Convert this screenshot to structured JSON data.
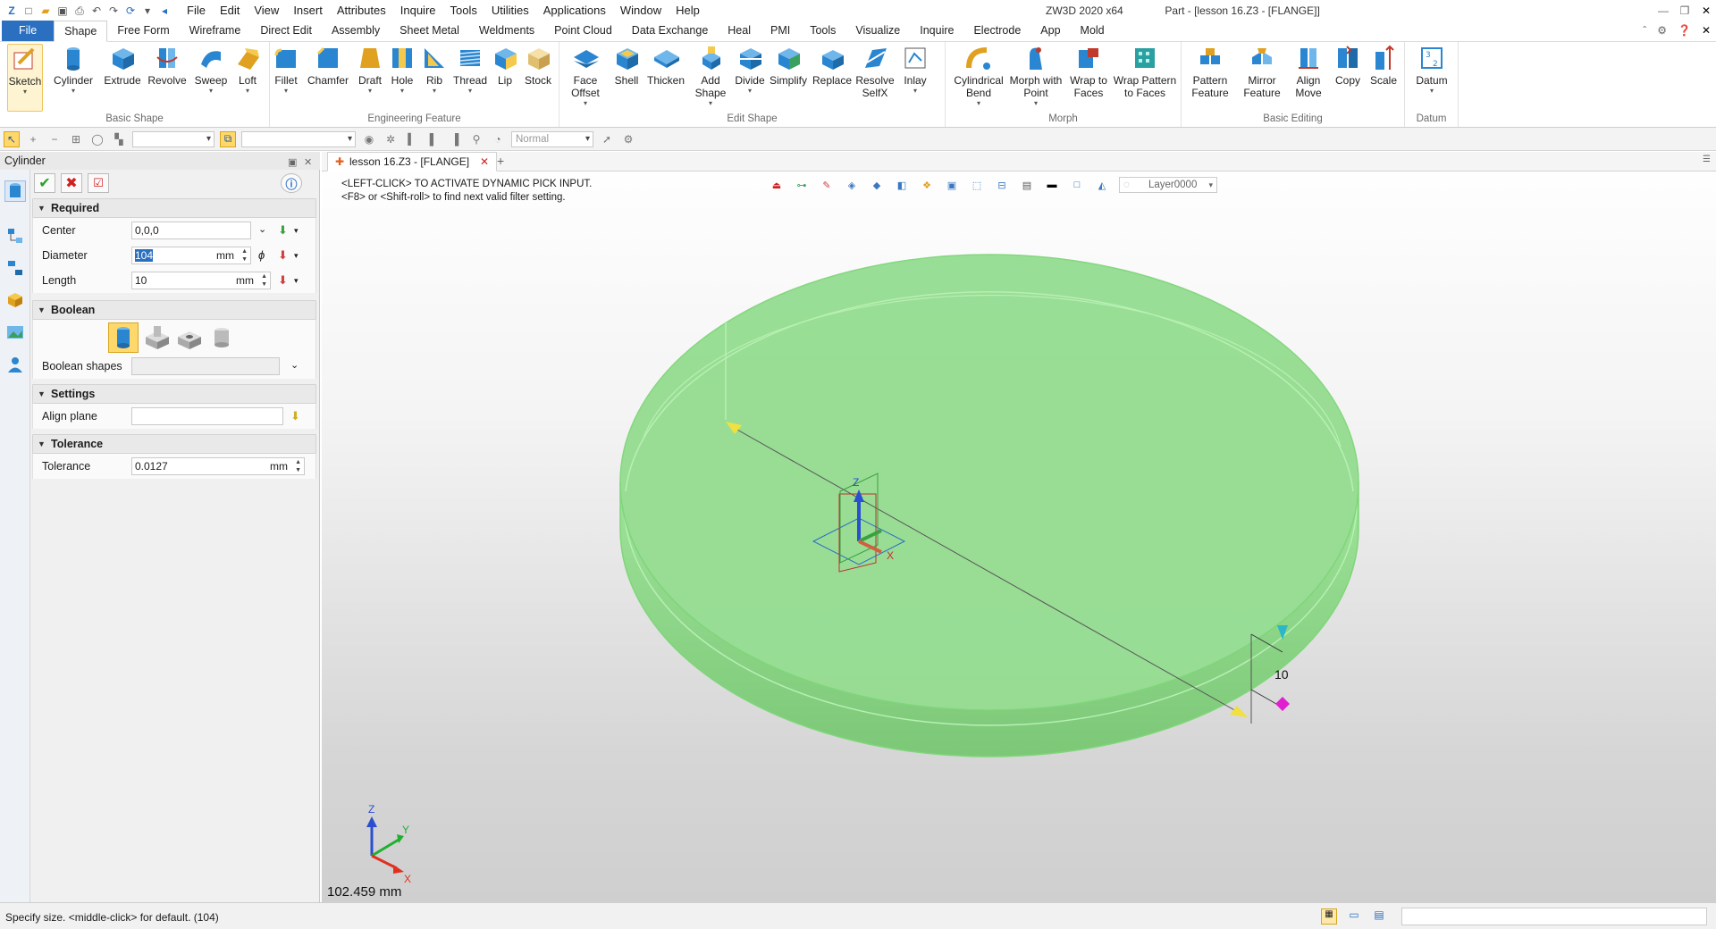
{
  "app": {
    "title": "ZW3D 2020 x64",
    "document_title": "Part - [lesson 16.Z3 - [FLANGE]]"
  },
  "menu": [
    "File",
    "Edit",
    "View",
    "Insert",
    "Attributes",
    "Inquire",
    "Tools",
    "Utilities",
    "Applications",
    "Window",
    "Help"
  ],
  "ribbon_tabs": [
    "File",
    "Shape",
    "Free Form",
    "Wireframe",
    "Direct Edit",
    "Assembly",
    "Sheet Metal",
    "Weldments",
    "Point Cloud",
    "Data Exchange",
    "Heal",
    "PMI",
    "Tools",
    "Visualize",
    "Inquire",
    "Electrode",
    "App",
    "Mold"
  ],
  "active_tab": "Shape",
  "ribbon_groups": {
    "basic_shape": {
      "label": "Basic Shape",
      "buttons": [
        "Sketch",
        "Cylinder",
        "Extrude",
        "Revolve",
        "Sweep",
        "Loft"
      ]
    },
    "engineering_feature": {
      "label": "Engineering Feature",
      "buttons": [
        "Fillet",
        "Chamfer",
        "Draft",
        "Hole",
        "Rib",
        "Thread",
        "Lip",
        "Stock"
      ]
    },
    "edit_shape": {
      "label": "Edit Shape",
      "buttons": [
        "Face Offset",
        "Shell",
        "Thicken",
        "Add Shape",
        "Divide",
        "Simplify",
        "Replace",
        "Resolve SelfX",
        "Inlay"
      ]
    },
    "morph": {
      "label": "Morph",
      "buttons": [
        "Cylindrical Bend",
        "Morph with Point",
        "Wrap to Faces",
        "Wrap Pattern to Faces"
      ]
    },
    "basic_editing": {
      "label": "Basic Editing",
      "buttons": [
        "Pattern Feature",
        "Mirror Feature",
        "Align Move",
        "Copy",
        "Scale"
      ]
    },
    "datum": {
      "label": "Datum",
      "buttons": [
        "Datum"
      ]
    }
  },
  "toolbar2": {
    "render_mode": "Normal"
  },
  "panel": {
    "title": "Cylinder",
    "sections": {
      "required": "Required",
      "boolean": "Boolean",
      "settings": "Settings",
      "tolerance": "Tolerance"
    },
    "fields": {
      "center": {
        "label": "Center",
        "value": "0,0,0"
      },
      "diameter": {
        "label": "Diameter",
        "value": "104",
        "unit": "mm"
      },
      "length": {
        "label": "Length",
        "value": "10",
        "unit": "mm"
      },
      "boolean_shapes": {
        "label": "Boolean shapes",
        "value": ""
      },
      "align_plane": {
        "label": "Align plane",
        "value": ""
      },
      "tolerance": {
        "label": "Tolerance",
        "value": "0.0127",
        "unit": "mm"
      }
    }
  },
  "viewport": {
    "doc_tab": "lesson 16.Z3 - [FLANGE]",
    "prompt_line1": "<LEFT-CLICK> TO ACTIVATE DYNAMIC PICK INPUT.",
    "prompt_line2": "<F8> or <Shift-roll> to find next valid filter setting.",
    "layer": "Layer0000",
    "dim_label": "10",
    "axis_x": "X",
    "axis_y": "Y",
    "axis_z": "Z",
    "measurement": "102.459 mm",
    "colors": {
      "solid": "#90dc8c",
      "solid_edge": "#6fd06a"
    }
  },
  "status": {
    "text": "Specify size.   <middle-click> for default. (104)"
  }
}
